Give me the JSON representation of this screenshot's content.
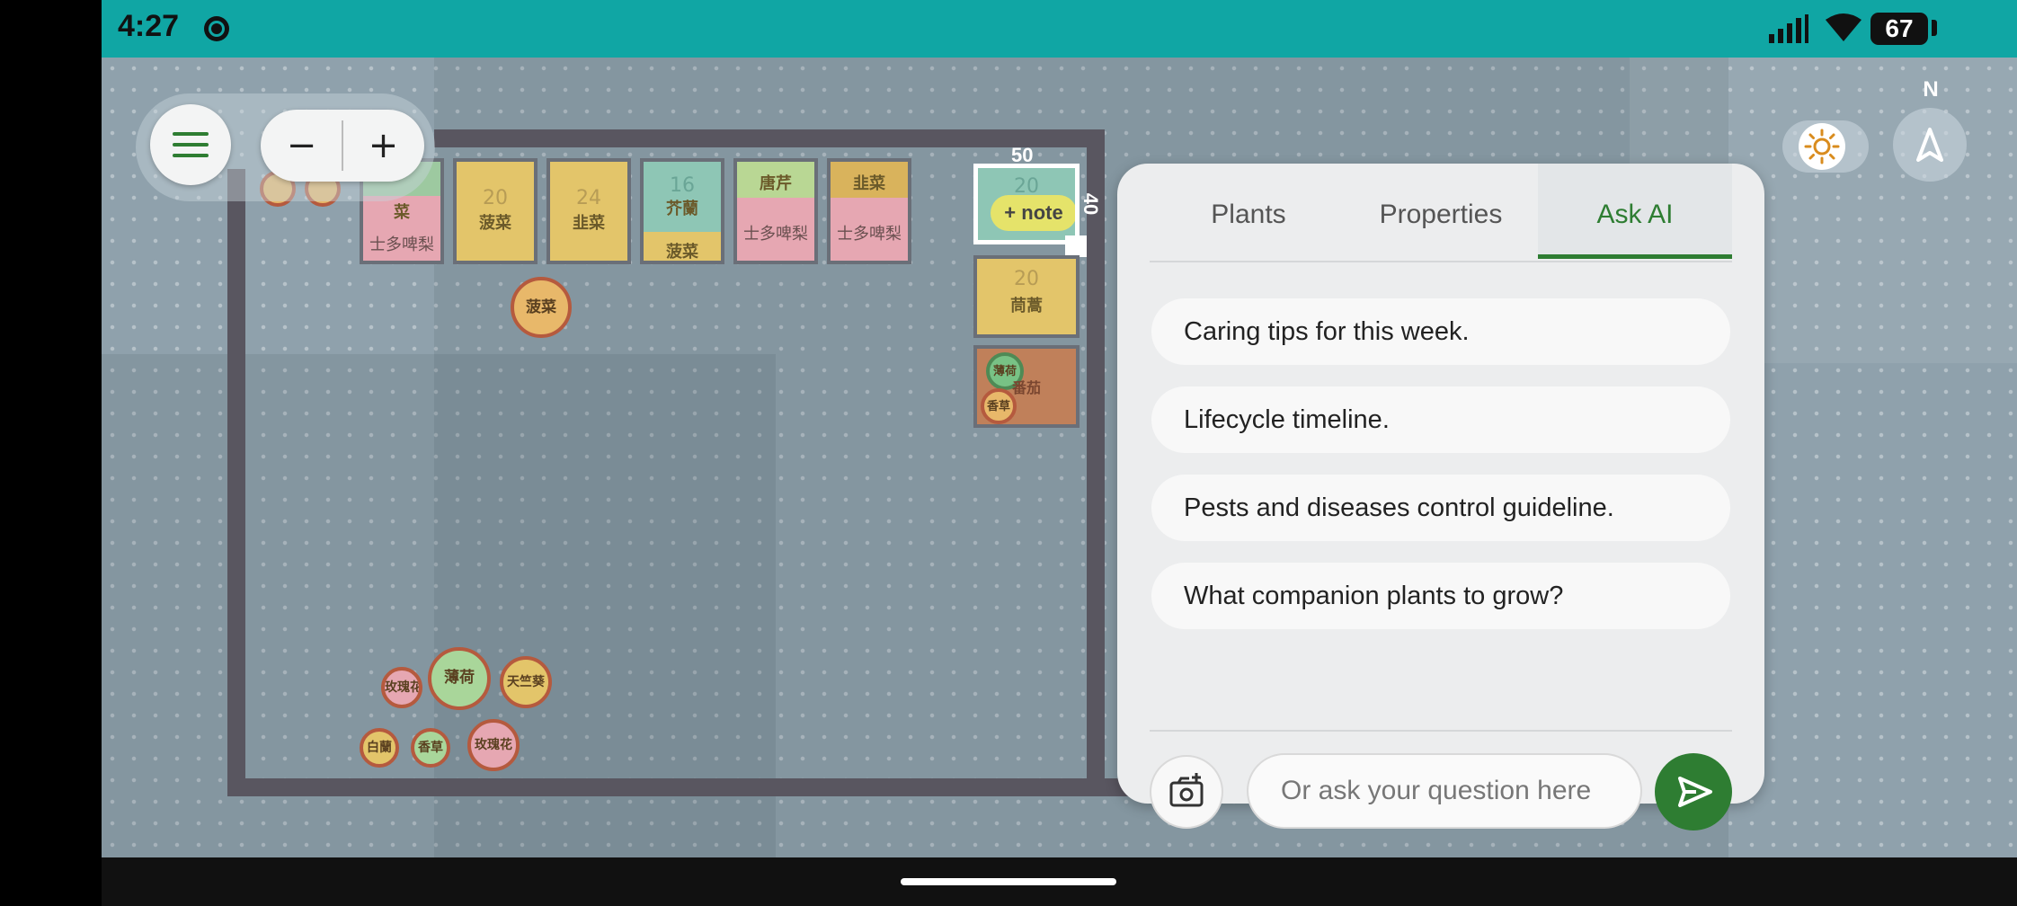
{
  "status_bar": {
    "time": "4:27",
    "battery": "67",
    "icons": [
      "chat-bubble-icon",
      "signal-icon",
      "wifi-icon",
      "battery-icon"
    ]
  },
  "toolbar": {
    "menu_icon": "hamburger-menu-icon",
    "zoom_out": "−",
    "zoom_in": "+"
  },
  "controls": {
    "theme_icon": "sun-icon",
    "compass_label": "N",
    "compass_icon": "navigation-arrow-icon"
  },
  "garden": {
    "top_beds": [
      {
        "top_label": "",
        "bottom_label": "菜",
        "bottom2_label": "士多啤梨"
      },
      {
        "count": "20",
        "label": "菠菜"
      },
      {
        "count": "24",
        "label": "韭菜"
      },
      {
        "count": "16",
        "label": "芥蘭",
        "bottom_label": "菠菜"
      },
      {
        "top_label": "唐芹",
        "bottom_label": "士多啤梨"
      },
      {
        "top_label": "韭菜",
        "bottom_label": "士多啤梨"
      }
    ],
    "selected_bed": {
      "width": "50",
      "height": "40",
      "count": "20",
      "note_label": "+ note"
    },
    "right_bed": {
      "count": "20",
      "label": "茼蒿"
    },
    "herb_bed": {
      "plants": [
        "薄荷",
        "香草",
        "番茄"
      ]
    },
    "plants": [
      {
        "label": "菠菜"
      },
      {
        "label": "玫瑰花"
      },
      {
        "label": "薄荷"
      },
      {
        "label": "天竺葵"
      },
      {
        "label": "白蘭"
      },
      {
        "label": "香草"
      },
      {
        "label": "玫瑰花"
      }
    ]
  },
  "ai_panel": {
    "tabs": [
      {
        "label": "Plants",
        "active": false
      },
      {
        "label": "Properties",
        "active": false
      },
      {
        "label": "Ask AI",
        "active": true
      }
    ],
    "suggestions": [
      "Caring tips for this week.",
      "Lifecycle timeline.",
      "Pests and diseases control guideline.",
      "What companion plants to grow?"
    ],
    "input_placeholder": "Or ask your question here",
    "input_value": "",
    "camera_icon": "add-photo-camera-icon",
    "send_icon": "send-icon"
  },
  "colors": {
    "status_bar": "#10a6a4",
    "accent": "#2e7d32",
    "canvas": "#8fa1ac"
  }
}
